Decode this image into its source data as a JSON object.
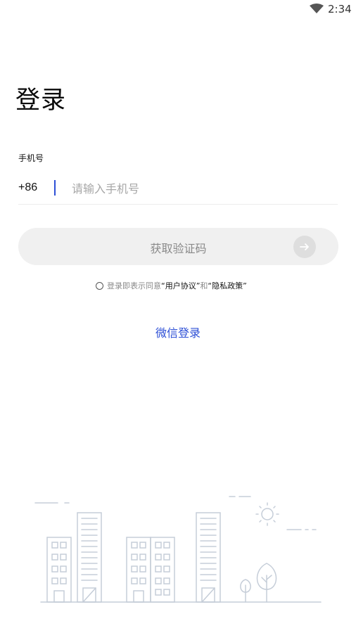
{
  "status_bar": {
    "time": "2:34",
    "icons": [
      "wifi-icon"
    ]
  },
  "login": {
    "title": "登录",
    "phone_label": "手机号",
    "country_code": "+86",
    "phone_value": "",
    "phone_placeholder": "请输入手机号",
    "get_code_label": "获取验证码",
    "submit_icon": "arrow-right-icon",
    "agreement": {
      "prefix": "登录即表示同意",
      "user_agreement": "“用户协议”",
      "conjunction": "和",
      "privacy_policy": "“隐私政策”",
      "checked": false
    },
    "wechat_login_label": "微信登录"
  },
  "illustration": {
    "icons": [
      "city-buildings-illustration",
      "sun-icon",
      "tree-icon"
    ]
  },
  "colors": {
    "accent": "#2d4fd6",
    "button_bg": "#f0f0f0",
    "button_text": "#8a8a8a",
    "placeholder": "#a7a7a7",
    "illustration_line": "#c5cdd8"
  }
}
